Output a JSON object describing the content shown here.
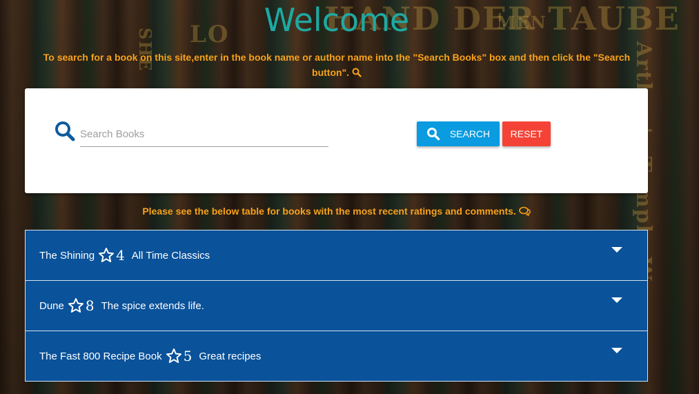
{
  "page": {
    "title": "Welcome",
    "instructions": "To search for a book on this site,enter in the book name or author name into the \"Search Books\" box and then click the \"Search button\".",
    "subtitle": "Please see the below table for books with the most recent ratings and comments."
  },
  "background_spines": [
    "HAND DER TAUBE",
    "MEN",
    "Arthur's Temple War",
    "SHE",
    "LO"
  ],
  "search": {
    "placeholder": "Search Books",
    "value": "",
    "search_button": "SEARCH",
    "reset_button": "RESET"
  },
  "books": [
    {
      "title": "The Shining",
      "rating": "4",
      "comment": "All Time Classics"
    },
    {
      "title": "Dune",
      "rating": "8",
      "comment": "The spice extends life."
    },
    {
      "title": "The Fast 800 Recipe Book",
      "rating": "5",
      "comment": "Great recipes"
    }
  ],
  "colors": {
    "title": "#1fa9a3",
    "instructions": "#f7a21b",
    "search_button": "#0a9be0",
    "reset_button": "#f44336",
    "book_row": "#0a529a",
    "search_icon": "#0d5b9c"
  },
  "icons": {
    "instructions_icon": "search-icon",
    "subtitle_icon": "comments-icon",
    "rating_icon": "star-outline-icon",
    "expand_icon": "caret-down-icon"
  }
}
